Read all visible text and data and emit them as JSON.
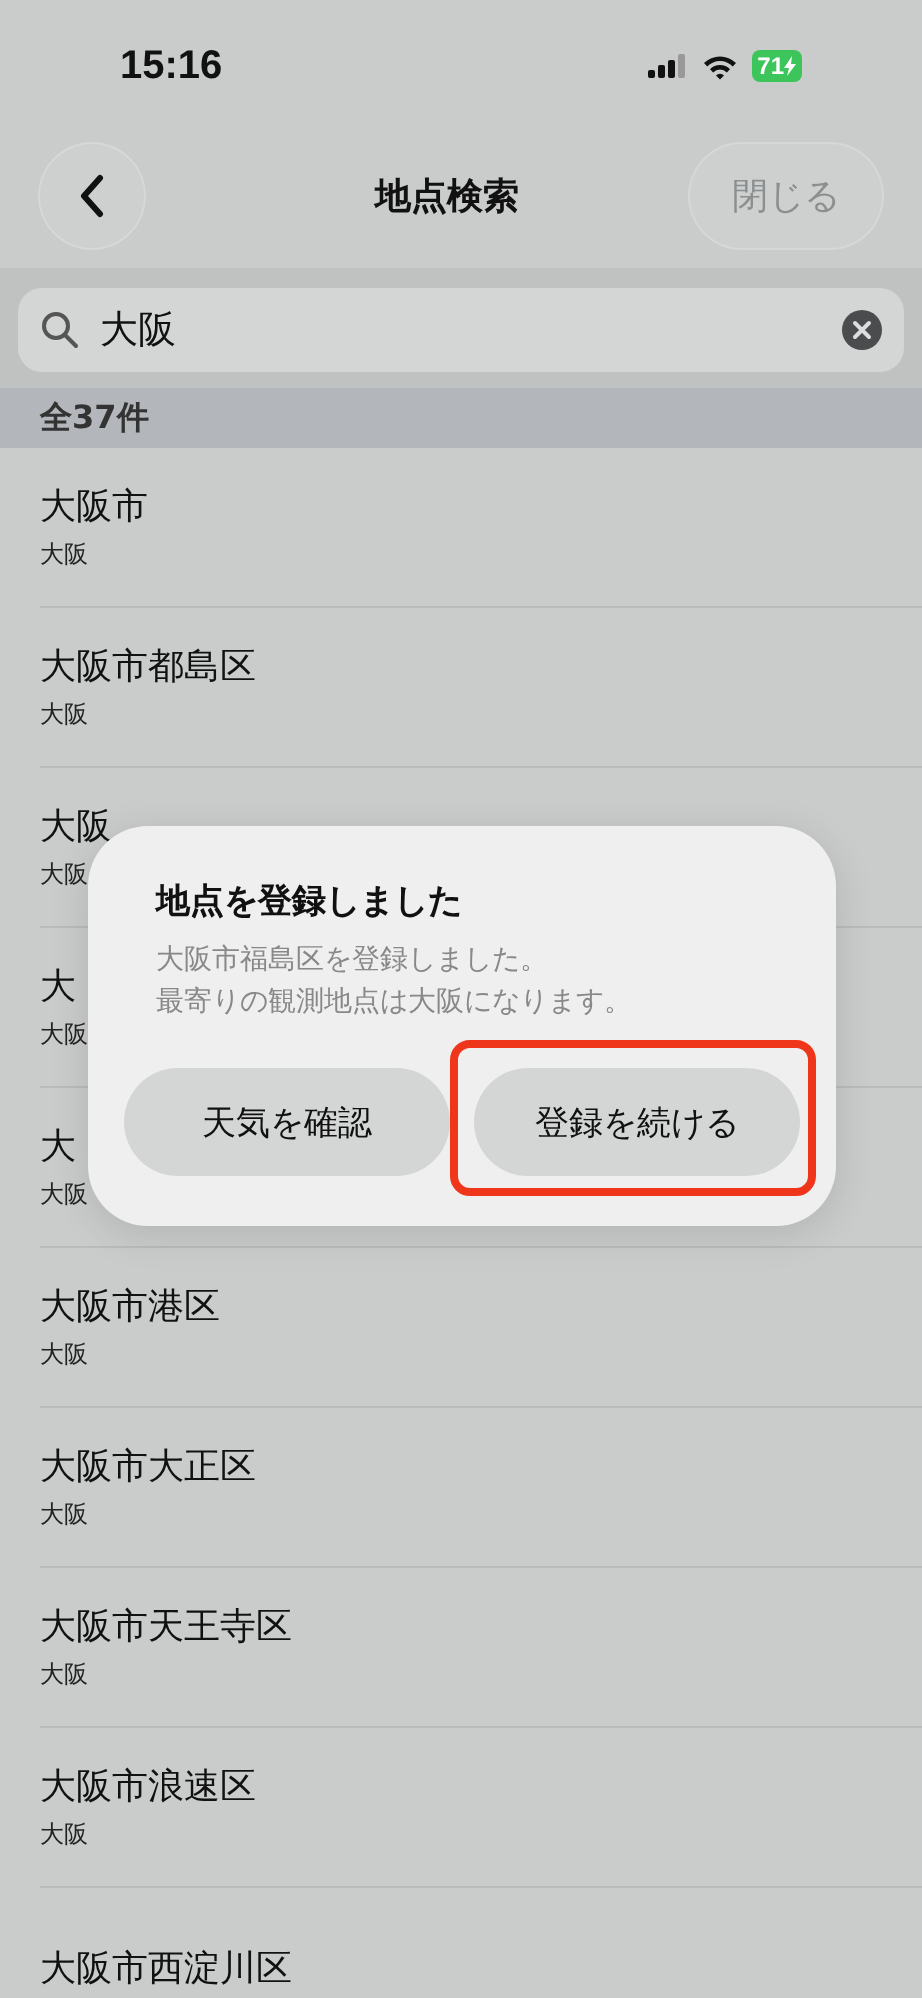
{
  "status_bar": {
    "time": "15:16",
    "battery": "71"
  },
  "nav": {
    "title": "地点検索",
    "close": "閉じる"
  },
  "search": {
    "value": "大阪"
  },
  "count": "全37件",
  "results": [
    {
      "name": "大阪市",
      "region": "大阪"
    },
    {
      "name": "大阪市都島区",
      "region": "大阪"
    },
    {
      "name": "大阪",
      "region": "大阪"
    },
    {
      "name": "大",
      "region": "大阪"
    },
    {
      "name": "大",
      "region": "大阪"
    },
    {
      "name": "大阪市港区",
      "region": "大阪"
    },
    {
      "name": "大阪市大正区",
      "region": "大阪"
    },
    {
      "name": "大阪市天王寺区",
      "region": "大阪"
    },
    {
      "name": "大阪市浪速区",
      "region": "大阪"
    },
    {
      "name": "大阪市西淀川区"
    }
  ],
  "dialog": {
    "title": "地点を登録しました",
    "message": [
      "大阪市福島区を登録しました。",
      "最寄りの観測地点は大阪になります。"
    ],
    "buttons": [
      {
        "label": "天気を確認",
        "highlighted": false
      },
      {
        "label": "登録を続ける",
        "highlighted": true
      }
    ]
  }
}
